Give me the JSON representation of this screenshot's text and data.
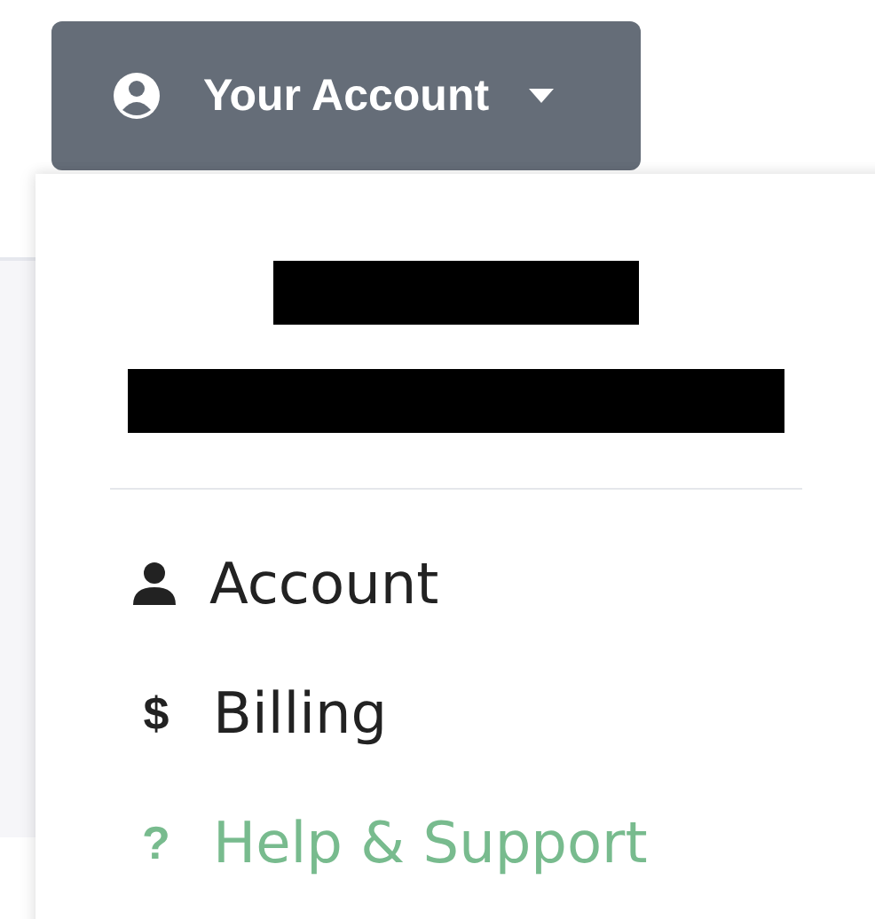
{
  "account_button": {
    "label": "Your Account",
    "expanded": true
  },
  "identity": [
    {
      "kind": "name"
    },
    {
      "kind": "email"
    }
  ],
  "menu_items": [
    {
      "kind": "icon",
      "label": "Account",
      "highlighted": false
    },
    {
      "kind": "glyph",
      "glyph": "$",
      "label": "Billing",
      "highlighted": false
    },
    {
      "kind": "glyph",
      "glyph": "?",
      "label": "Help & Support",
      "highlighted": true
    }
  ]
}
